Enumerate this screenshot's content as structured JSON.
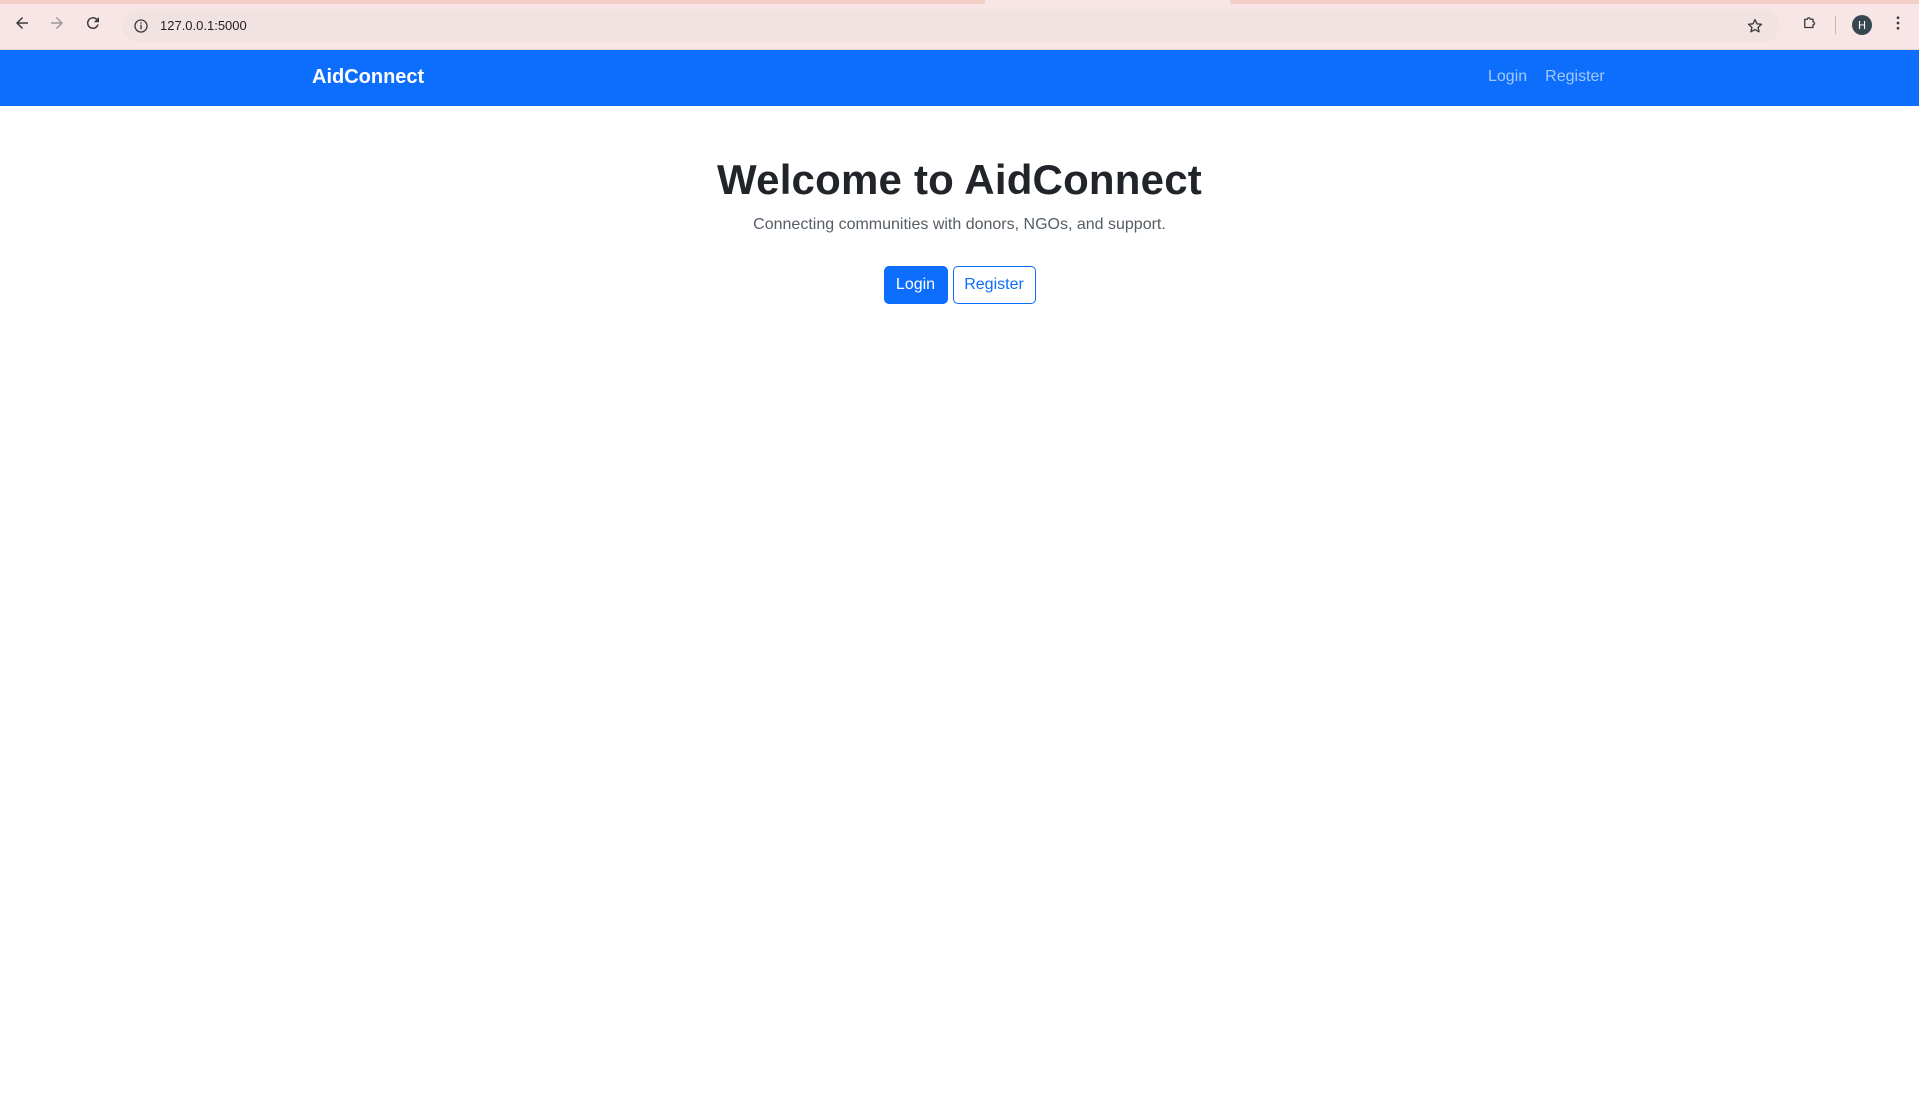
{
  "browser": {
    "url": "127.0.0.1:5000",
    "profile_initial": "H",
    "icons": {
      "back": "arrow-left-icon",
      "forward": "arrow-right-icon",
      "reload": "reload-icon",
      "site_info": "info-icon",
      "bookmark": "star-icon",
      "extensions": "puzzle-icon",
      "menu": "kebab-menu-icon"
    }
  },
  "navbar": {
    "brand": "AidConnect",
    "links": [
      {
        "label": "Login"
      },
      {
        "label": "Register"
      }
    ],
    "color": "#0d6efd"
  },
  "hero": {
    "title": "Welcome to AidConnect",
    "subtitle": "Connecting communities with donors, NGOs, and support.",
    "primary_button": "Login",
    "secondary_button": "Register"
  }
}
